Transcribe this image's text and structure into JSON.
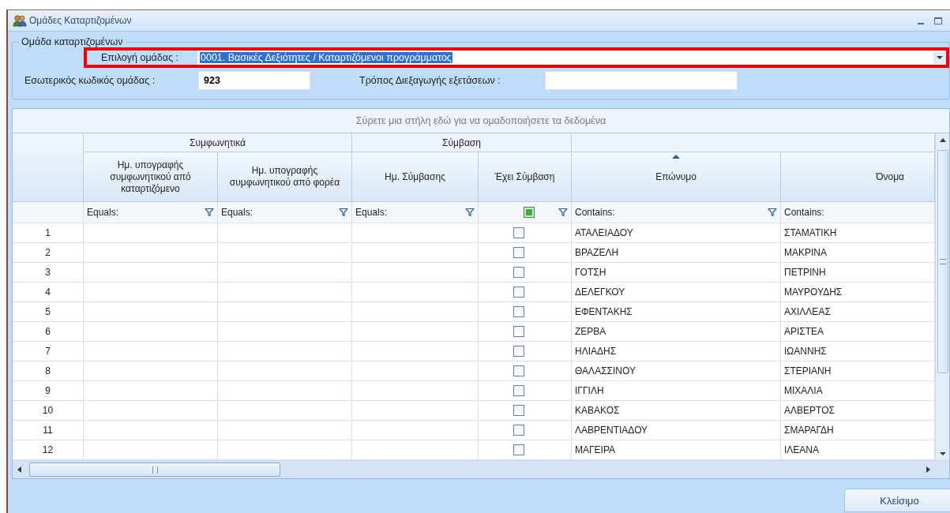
{
  "window": {
    "title": "Ομάδες Καταρτιζομένων"
  },
  "group_box": {
    "title": "Ομάδα καταρτιζομένων",
    "group_select": {
      "label": "Επιλογή ομάδας :",
      "value": "0001. Βασικές Δεξιότητες / Καταρτιζόμενοι προγράμματος",
      "highlighted": true
    },
    "internal_code": {
      "label": "Εσωτερικός κωδικός ομάδας :",
      "value": "923"
    },
    "exam_mode": {
      "label": "Τρόπος Διεξαγωγής εξετάσεων :"
    }
  },
  "grid": {
    "group_panel_hint": "Σύρετε μια στήλη εδώ για να ομαδοποιήσετε τα δεδομένα",
    "bands": [
      {
        "label": "Συμφωνητικά",
        "columns": [
          {
            "title": "Ημ. υπογραφής συμφωνητικού από καταρτιζόμενο",
            "kind": "date",
            "filter": "Equals:",
            "filter_icon": true
          },
          {
            "title": "Ημ. υπογραφής συμφωνητικού από φορέα",
            "kind": "date",
            "filter": "Equals:",
            "filter_icon": true
          }
        ]
      },
      {
        "label": "Σύμβαση",
        "columns": [
          {
            "title": "Ημ. Σύμβασης",
            "kind": "date",
            "filter": "Equals:",
            "filter_icon": true
          },
          {
            "title": "Έχει Σύμβαση",
            "kind": "check",
            "filter_indeterminate": true,
            "filter_icon": true
          }
        ]
      },
      {
        "columns": [
          {
            "title": "Επώνυμο",
            "kind": "text",
            "filter": "Contains:",
            "filter_icon": true,
            "sorted": true
          },
          {
            "title": "Όνομα",
            "kind": "text",
            "filter": "Contains:",
            "filter_icon": false
          }
        ]
      }
    ],
    "rows": [
      {
        "number": "1",
        "checked": false,
        "values": [
          "ΑΤΑΛΕΙΑΔΟΥ",
          "ΣΤΑΜΑΤΙΚΗ"
        ]
      },
      {
        "number": "2",
        "checked": false,
        "values": [
          "ΒΡΑΖΕΛΗ",
          "ΜΑΚΡΙΝΑ"
        ]
      },
      {
        "number": "3",
        "checked": false,
        "values": [
          "ΓΟΤΣΗ",
          "ΠΕΤΡΙΝΗ"
        ]
      },
      {
        "number": "4",
        "checked": false,
        "values": [
          "ΔΕΛΕΓΚΟΥ",
          "ΜΑΥΡΟΥΔΗΣ"
        ]
      },
      {
        "number": "5",
        "checked": false,
        "values": [
          "ΕΦΕΝΤΑΚΗΣ",
          "ΑΧΙΛΛΕΑΣ"
        ]
      },
      {
        "number": "6",
        "checked": false,
        "values": [
          "ΖΕΡΒΑ",
          "ΑΡΙΣΤΕΑ"
        ]
      },
      {
        "number": "7",
        "checked": false,
        "values": [
          "ΗΛΙΑΔΗΣ",
          "ΙΩΑΝΝΗΣ"
        ]
      },
      {
        "number": "8",
        "checked": false,
        "values": [
          "ΘΑΛΑΣΣΙΝΟΥ",
          "ΣΤΕΡΙΑΝΗ"
        ]
      },
      {
        "number": "9",
        "checked": false,
        "values": [
          "ΙΓΓΙΛΗ",
          "ΜΙΧΑΛΙΑ"
        ]
      },
      {
        "number": "10",
        "checked": false,
        "values": [
          "ΚΑΒΑΚΟΣ",
          "ΑΛΒΕΡΤΟΣ"
        ]
      },
      {
        "number": "11",
        "checked": false,
        "values": [
          "ΛΑΒΡΕΝΤΙΑΔΟΥ",
          "ΣΜΑΡΑΓΔΗ"
        ]
      },
      {
        "number": "12",
        "checked": false,
        "values": [
          "ΜΑΓΕΙΡΑ",
          "ΙΛΕΑΝΑ"
        ]
      }
    ]
  },
  "buttons": {
    "close": "Κλείσιμο"
  }
}
